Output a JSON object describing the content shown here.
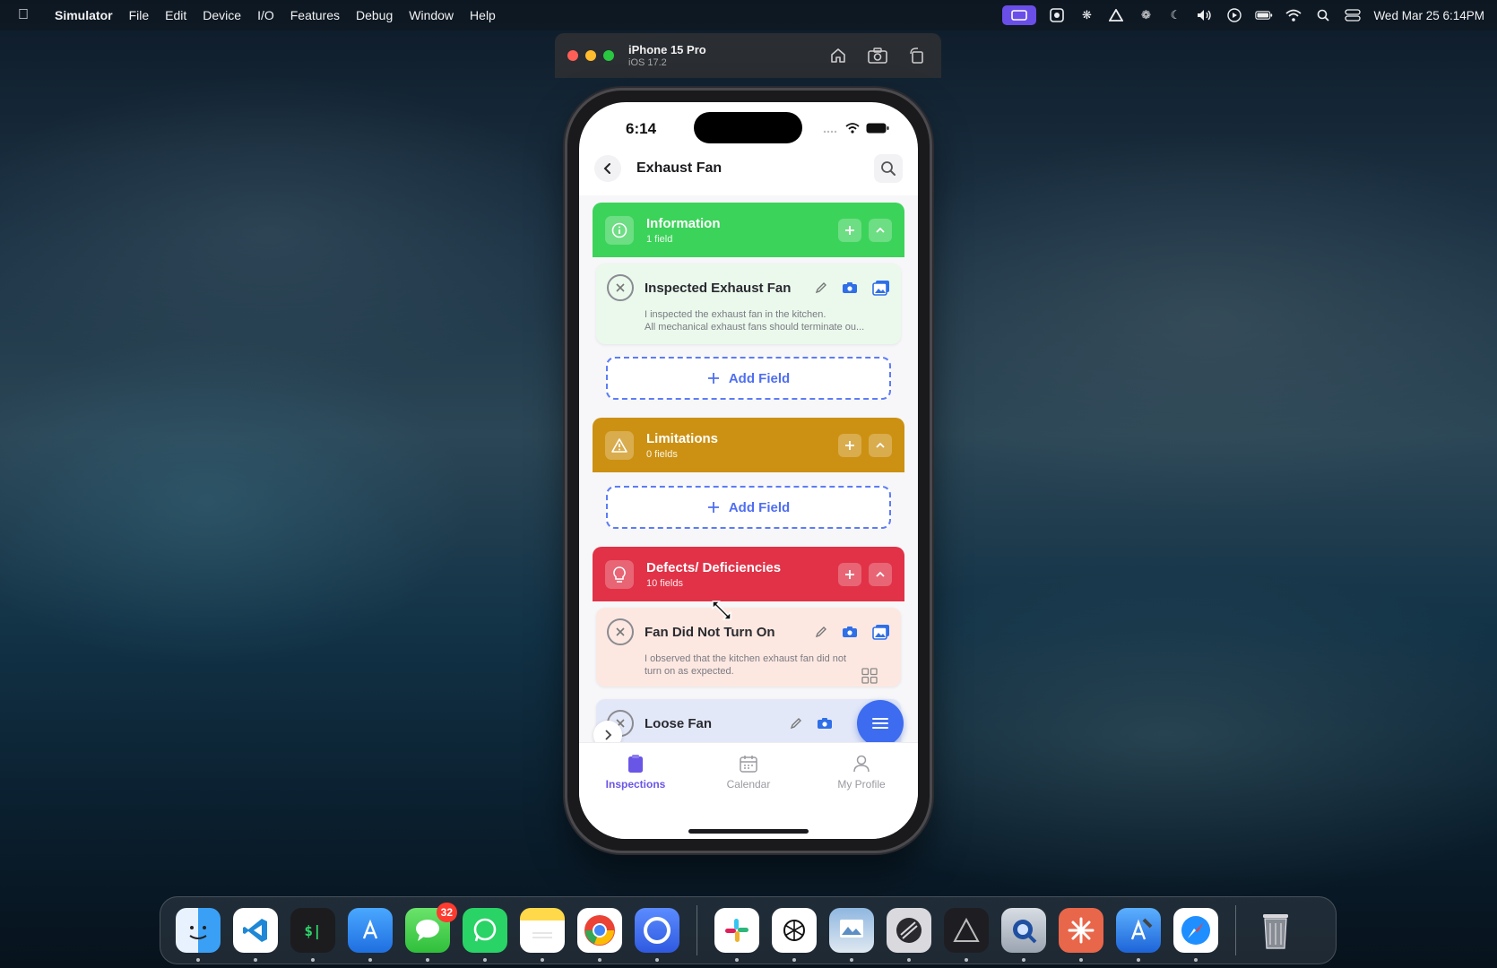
{
  "menubar": {
    "app_name": "Simulator",
    "items": [
      "File",
      "Edit",
      "Device",
      "I/O",
      "Features",
      "Debug",
      "Window",
      "Help"
    ],
    "clock": "Wed Mar 25  6:14PM"
  },
  "simulator": {
    "device_name": "iPhone 15 Pro",
    "os_version": "iOS 17.2"
  },
  "phone": {
    "status_time": "6:14",
    "nav_title": "Exhaust Fan",
    "sections": {
      "information": {
        "title": "Information",
        "count": "1 field",
        "color": "#3cd35a"
      },
      "limitations": {
        "title": "Limitations",
        "count": "0 fields",
        "color": "#cc9112"
      },
      "defects": {
        "title": "Defects/ Deficiencies",
        "count": "10 fields",
        "color": "#e13247"
      }
    },
    "fields": {
      "inspected": {
        "title": "Inspected Exhaust Fan",
        "description": "I inspected the exhaust fan in the kitchen.\nAll mechanical exhaust fans should terminate ou..."
      },
      "did_not_turn_on": {
        "title": "Fan Did Not Turn On",
        "description": "I observed that the kitchen exhaust fan did not\nturn on as expected."
      },
      "loose_fan": {
        "title": "Loose Fan"
      }
    },
    "add_field_label": "Add Field",
    "tabs": {
      "inspections": "Inspections",
      "calendar": "Calendar",
      "profile": "My Profile"
    }
  },
  "dock": {
    "apps": [
      "finder-icon",
      "vscode-icon",
      "terminal-icon",
      "xcode-instruments-icon",
      "messages-icon",
      "whatsapp-icon",
      "notes-icon",
      "chrome-icon",
      "circle-app-icon",
      "slack-icon",
      "chatgpt-icon",
      "preview-icon",
      "stripes-app-icon",
      "affinity-icon",
      "quicktime-icon",
      "claude-icon",
      "xcode-icon",
      "safari-icon",
      "trash-icon"
    ],
    "messages_badge": "32"
  }
}
